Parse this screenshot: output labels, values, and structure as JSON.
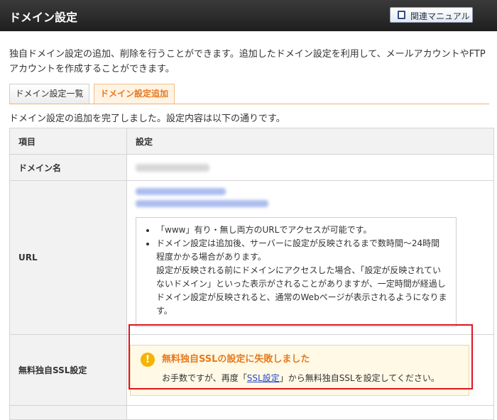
{
  "header": {
    "title": "ドメイン設定",
    "manual_button": "関連マニュアル"
  },
  "description": "独自ドメイン設定の追加、削除を行うことができます。追加したドメイン設定を利用して、メールアカウントやFTPアカウントを作成することができます。",
  "tabs": [
    {
      "label": "ドメイン設定一覧",
      "active": false
    },
    {
      "label": "ドメイン設定追加",
      "active": true
    }
  ],
  "completion_message": "ドメイン設定の追加を完了しました。設定内容は以下の通りです。",
  "table": {
    "col_item": "項目",
    "col_setting": "設定",
    "row_domain_label": "ドメイン名",
    "row_url_label": "URL",
    "row_ssl_label": "無料独自SSL設定",
    "url_notes": {
      "note1": "「www」有り・無し両方のURLでアクセスが可能です。",
      "note2": "ドメイン設定は追加後、サーバーに設定が反映されるまで数時間〜24時間程度かかる場合があります。",
      "note2b": "設定が反映される前にドメインにアクセスした場合、「設定が反映されていないドメイン」といった表示がされることがありますが、一定時間が経過しドメイン設定が反映されると、通常のWebページが表示されるようになります。"
    },
    "ssl_warning": {
      "title": "無料独自SSLの設定に失敗しました",
      "text_before": "お手数ですが、再度「",
      "link": "SSL設定",
      "text_after": "」から無料独自SSLを設定してください。"
    }
  },
  "colors": {
    "accent_orange": "#e8791d",
    "error_red": "#e0141e",
    "link_blue": "#2345c9"
  }
}
